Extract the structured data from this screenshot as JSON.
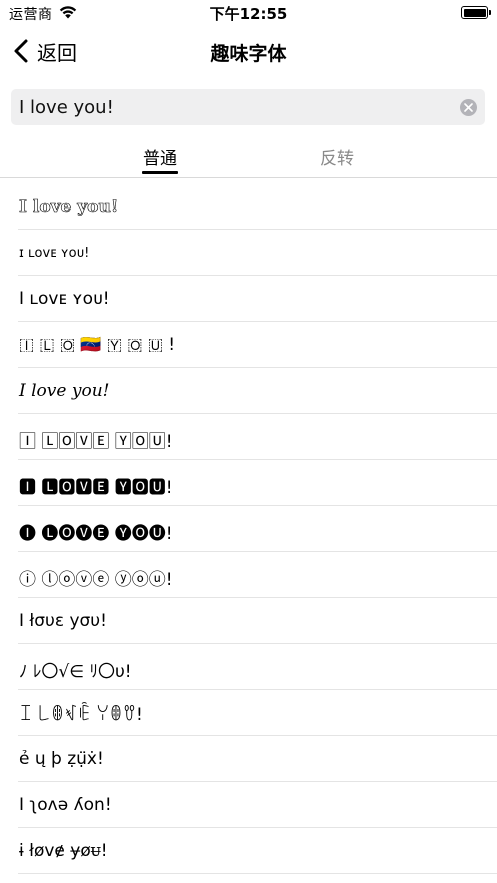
{
  "status_bar": {
    "carrier": "运营商",
    "time": "下午12:55"
  },
  "nav": {
    "back_label": "返回",
    "title": "趣味字体"
  },
  "search": {
    "value": "I love you!"
  },
  "tabs": [
    {
      "label": "普通",
      "active": true
    },
    {
      "label": "反转",
      "active": false
    }
  ],
  "font_styles": [
    {
      "text": "I love you!",
      "style": "outline"
    },
    {
      "text": "ɪ ʟᴏᴠᴇ ʏᴏᴜ!",
      "style": "small"
    },
    {
      "text": "I ʟᴏᴠᴇ ʏᴏᴜ!",
      "style": "plain"
    },
    {
      "text": "🇮 🇱 🇴 🇻🇪 🇾 🇴 🇺 !",
      "style": "plain"
    },
    {
      "text": "𝐼 𝑙𝑜𝑣𝑒 𝑦𝑜𝑢!",
      "style": "italic"
    },
    {
      "text": "🄸 🄻🄾🅅🄴 🅈🄾🅄!",
      "style": "plain"
    },
    {
      "text": "🅸 🅻🅾🆅🅴 🆈🅾🆄!",
      "style": "plain"
    },
    {
      "text": "🅘 🅛🅞🅥🅔 🅨🅞🅤!",
      "style": "plain"
    },
    {
      "text": "ⓘ ⓛⓞⓥⓔ ⓨⓞⓤ!",
      "style": "plain"
    },
    {
      "text": "I łσυɛ уσυ!",
      "style": "plain"
    },
    {
      "text": "ﾉ ﾚ〇√∈ ﾘ〇υ!",
      "style": "plain"
    },
    {
      "text": "ꀤ ꒒ꂦꃴꍟ ꌩꂦꀎ!",
      "style": "plain"
    },
    {
      "text": "ẻ ų þ ẓụ̈ẋ!",
      "style": "plain"
    },
    {
      "text": "I ʅoʌǝ ʎon!",
      "style": "plain"
    },
    {
      "text": "ɨ łøvɇ ɏøᵾ!",
      "style": "plain"
    }
  ],
  "icons": {
    "back": "chevron-left-icon",
    "clear": "clear-circle-icon",
    "wifi": "wifi-icon",
    "battery": "battery-icon"
  }
}
